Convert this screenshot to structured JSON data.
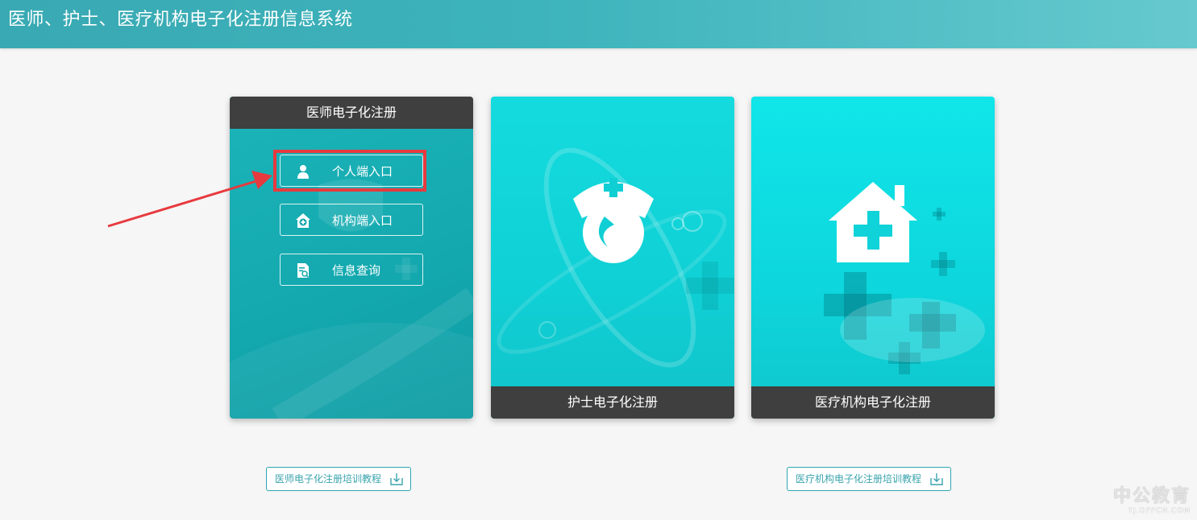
{
  "header": {
    "title": "医师、护士、医疗机构电子化注册信息系统"
  },
  "cards": {
    "doctor": {
      "title": "医师电子化注册",
      "buttons": [
        {
          "label": "个人端入口",
          "icon": "user-icon"
        },
        {
          "label": "机构端入口",
          "icon": "institution-icon"
        },
        {
          "label": "信息查询",
          "icon": "document-search-icon"
        }
      ]
    },
    "nurse": {
      "title": "护士电子化注册",
      "icon": "nurse-cap-icon"
    },
    "institution": {
      "title": "医疗机构电子化注册",
      "icon": "hospital-house-icon"
    }
  },
  "tutorials": {
    "doctor": "医师电子化注册培训教程",
    "institution": "医疗机构电子化注册培训教程"
  },
  "annotation": {
    "highlight_color": "#e73a3e"
  },
  "watermark": {
    "logo": "中公教育",
    "url": "TJ.OFFCN.COM"
  },
  "colors": {
    "header": "#3db3bb",
    "card_dark": "#3f3f3f",
    "doctor_card": "#13a8ae",
    "nurse_card": "#0fd0d5",
    "institution_card": "#0dd6dc"
  }
}
